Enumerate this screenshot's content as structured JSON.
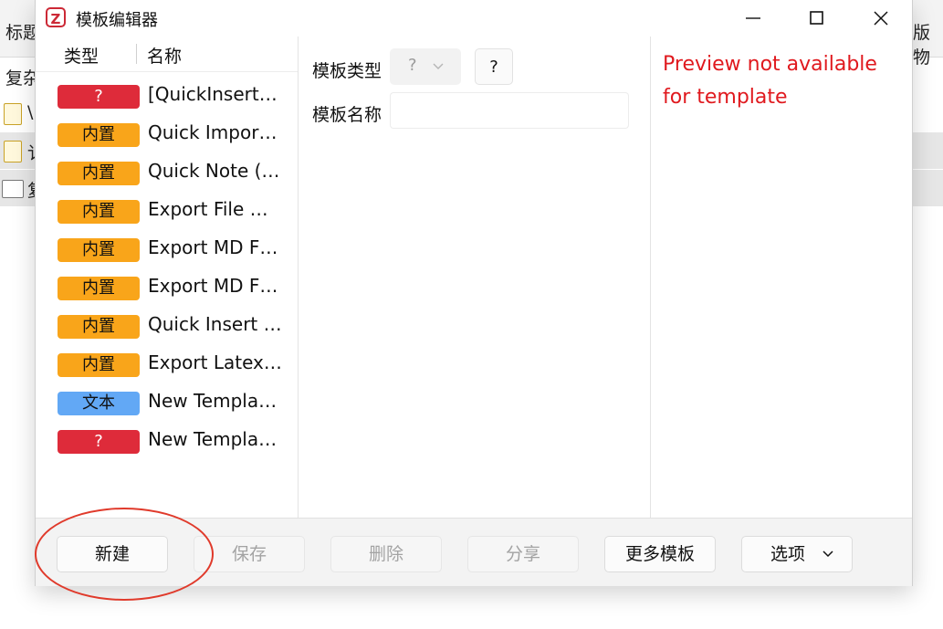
{
  "background": {
    "tab_left_partial": "标题",
    "tab_right_partial": "版物",
    "row_label_partial": "复杂",
    "item_labels_partial": [
      "\\",
      "讠",
      "复"
    ]
  },
  "dialog": {
    "title": "模板编辑器",
    "logo_letter": "Z"
  },
  "template_list": {
    "col_type": "类型",
    "col_name": "名称",
    "items": [
      {
        "type": "?",
        "color": "#de2b3a",
        "name": "[QuickInsert…"
      },
      {
        "type": "内置",
        "color": "#f9a51a",
        "name": "Quick Impor…"
      },
      {
        "type": "内置",
        "color": "#f9a51a",
        "name": "Quick Note (…"
      },
      {
        "type": "内置",
        "color": "#f9a51a",
        "name": "Export File …"
      },
      {
        "type": "内置",
        "color": "#f9a51a",
        "name": "Export MD F…"
      },
      {
        "type": "内置",
        "color": "#f9a51a",
        "name": "Export MD F…"
      },
      {
        "type": "内置",
        "color": "#f9a51a",
        "name": "Quick Insert …"
      },
      {
        "type": "内置",
        "color": "#f9a51a",
        "name": "Export Latex…"
      },
      {
        "type": "文本",
        "color": "#62a8f5",
        "name": "New Templa…"
      },
      {
        "type": "?",
        "color": "#de2b3a",
        "name": "New Templa…"
      }
    ]
  },
  "editor": {
    "type_label": "模板类型",
    "type_value": "?",
    "help_label": "?",
    "name_label": "模板名称",
    "name_value": ""
  },
  "preview": {
    "message": "Preview not available for template"
  },
  "footer": {
    "new_label": "新建",
    "save_label": "保存",
    "delete_label": "删除",
    "share_label": "分享",
    "more_templates_label": "更多模板",
    "options_label": "选项"
  },
  "colors": {
    "accent_red": "#de2b3a",
    "builtin_orange": "#f9a51a",
    "text_blue": "#62a8f5",
    "preview_red": "#e0191e",
    "annotation_red": "#e03a2b"
  }
}
